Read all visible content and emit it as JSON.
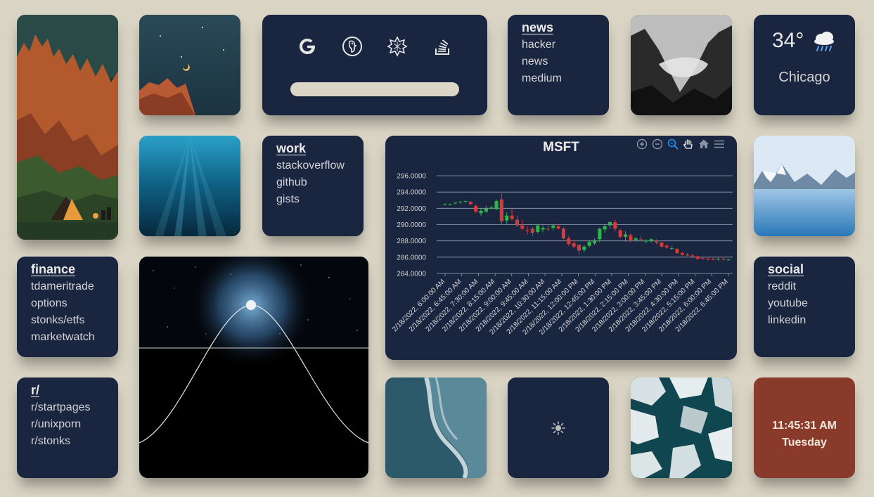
{
  "search": {
    "engines": [
      {
        "name": "Google",
        "icon": "google-icon"
      },
      {
        "name": "DuckDuckGo",
        "icon": "duckduckgo-icon"
      },
      {
        "name": "Wolfram Alpha",
        "icon": "wolfram-icon"
      },
      {
        "name": "Stack Overflow",
        "icon": "stackoverflow-icon"
      }
    ],
    "placeholder": ""
  },
  "news": {
    "title": "news",
    "links": [
      "hacker",
      "news",
      "medium"
    ]
  },
  "work": {
    "title": "work",
    "links": [
      "stackoverflow",
      "github",
      "gists"
    ]
  },
  "finance": {
    "title": "finance",
    "links": [
      "tdameritrade",
      "options",
      "stonks/etfs",
      "marketwatch"
    ]
  },
  "social": {
    "title": "social",
    "links": [
      "reddit",
      "youtube",
      "linkedin"
    ]
  },
  "reddit": {
    "title": "r/",
    "links": [
      "r/startpages",
      "r/unixporn",
      "r/stonks"
    ]
  },
  "weather": {
    "temp": "34°",
    "city": "Chicago",
    "icon": "rain-cloud-icon"
  },
  "clock": {
    "time": "11:45:31 AM",
    "day": "Tuesday"
  },
  "theme_toggle": {
    "icon": "sun-icon"
  },
  "colors": {
    "background": "#d9d4c4",
    "tile": "#1a2540",
    "clock_tile": "#8a3a2a",
    "candle_up": "#2fb24a",
    "candle_down": "#d43a3a"
  },
  "chart_data": {
    "type": "candlestick",
    "title": "MSFT",
    "ylim": [
      284,
      296
    ],
    "yticks": [
      "296.0000",
      "294.0000",
      "292.0000",
      "290.0000",
      "288.0000",
      "286.0000",
      "284.0000"
    ],
    "x_labels": [
      "2/18/2022, 6:00:00 AM",
      "2/18/2022, 6:45:00 AM",
      "2/18/2022, 7:30:00 AM",
      "2/18/2022, 8:15:00 AM",
      "2/18/2022, 9:00:00 AM",
      "2/18/2022, 9:45:00 AM",
      "2/18/2022, 10:30:00 AM",
      "2/18/2022, 11:15:00 AM",
      "2/18/2022, 12:00:00 PM",
      "2/18/2022, 12:45:00 PM",
      "2/18/2022, 1:30:00 PM",
      "2/18/2022, 2:15:00 PM",
      "2/18/2022, 3:00:00 PM",
      "2/18/2022, 3:45:00 PM",
      "2/18/2022, 4:30:00 PM",
      "2/18/2022, 5:15:00 PM",
      "2/18/2022, 6:00:00 PM",
      "2/18/2022, 6:45:00 PM"
    ],
    "ohlc": [
      [
        292.5,
        292.6,
        292.4,
        292.5
      ],
      [
        292.5,
        292.6,
        292.4,
        292.5
      ],
      [
        292.6,
        292.7,
        292.5,
        292.7
      ],
      [
        292.8,
        292.9,
        292.6,
        292.8
      ],
      [
        292.8,
        292.9,
        292.7,
        292.9
      ],
      [
        292.8,
        292.9,
        292.4,
        292.5
      ],
      [
        292.3,
        292.5,
        291.4,
        291.6
      ],
      [
        291.4,
        292.0,
        291.1,
        291.7
      ],
      [
        291.6,
        292.3,
        291.4,
        292.0
      ],
      [
        292.0,
        292.3,
        291.8,
        292.1
      ],
      [
        291.9,
        293.1,
        291.8,
        292.9
      ],
      [
        293.1,
        293.8,
        290.0,
        290.4
      ],
      [
        290.5,
        291.5,
        290.1,
        291.1
      ],
      [
        291.1,
        291.9,
        290.5,
        290.7
      ],
      [
        290.6,
        291.1,
        289.7,
        289.9
      ],
      [
        289.9,
        290.6,
        289.3,
        289.5
      ],
      [
        289.3,
        289.8,
        288.8,
        289.2
      ],
      [
        289.5,
        289.7,
        288.6,
        289.0
      ],
      [
        289.1,
        290.1,
        288.9,
        289.9
      ],
      [
        289.4,
        289.9,
        289.1,
        289.6
      ],
      [
        289.5,
        290.0,
        289.2,
        289.4
      ],
      [
        289.6,
        290.0,
        289.3,
        289.9
      ],
      [
        289.8,
        290.1,
        289.4,
        289.5
      ],
      [
        289.5,
        289.7,
        288.2,
        288.3
      ],
      [
        288.3,
        288.6,
        287.4,
        287.6
      ],
      [
        287.7,
        288.1,
        287.1,
        287.3
      ],
      [
        287.5,
        287.6,
        286.3,
        286.8
      ],
      [
        286.9,
        287.5,
        286.6,
        287.3
      ],
      [
        287.4,
        288.1,
        287.2,
        287.9
      ],
      [
        287.7,
        288.3,
        287.5,
        288.1
      ],
      [
        288.2,
        289.6,
        287.8,
        289.5
      ],
      [
        289.4,
        290.1,
        289.0,
        289.8
      ],
      [
        289.9,
        290.5,
        289.5,
        290.3
      ],
      [
        290.3,
        290.6,
        289.2,
        289.5
      ],
      [
        289.3,
        289.5,
        288.3,
        288.5
      ],
      [
        288.5,
        289.2,
        287.9,
        288.8
      ],
      [
        288.7,
        288.9,
        287.8,
        288.1
      ],
      [
        288.1,
        288.5,
        287.9,
        288.3
      ],
      [
        288.2,
        288.6,
        287.9,
        288.1
      ],
      [
        288.0,
        288.2,
        287.7,
        288.0
      ],
      [
        288.0,
        288.3,
        287.8,
        288.2
      ],
      [
        288.0,
        288.2,
        287.6,
        287.8
      ],
      [
        287.8,
        287.9,
        287.2,
        287.3
      ],
      [
        287.4,
        287.6,
        287.0,
        287.2
      ],
      [
        287.1,
        287.4,
        286.9,
        287.1
      ],
      [
        287.0,
        287.1,
        286.4,
        286.5
      ],
      [
        286.5,
        286.7,
        286.2,
        286.3
      ],
      [
        286.3,
        286.5,
        286.0,
        286.2
      ],
      [
        286.2,
        286.4,
        285.9,
        286.1
      ],
      [
        286.1,
        286.2,
        285.7,
        285.8
      ],
      [
        285.9,
        286.0,
        285.7,
        285.8
      ],
      [
        285.8,
        286.0,
        285.6,
        285.7
      ],
      [
        285.8,
        285.9,
        285.6,
        285.7
      ],
      [
        285.7,
        285.9,
        285.6,
        285.8
      ],
      [
        285.8,
        285.9,
        285.6,
        285.7
      ],
      [
        285.7,
        285.8,
        285.6,
        285.7
      ]
    ]
  }
}
